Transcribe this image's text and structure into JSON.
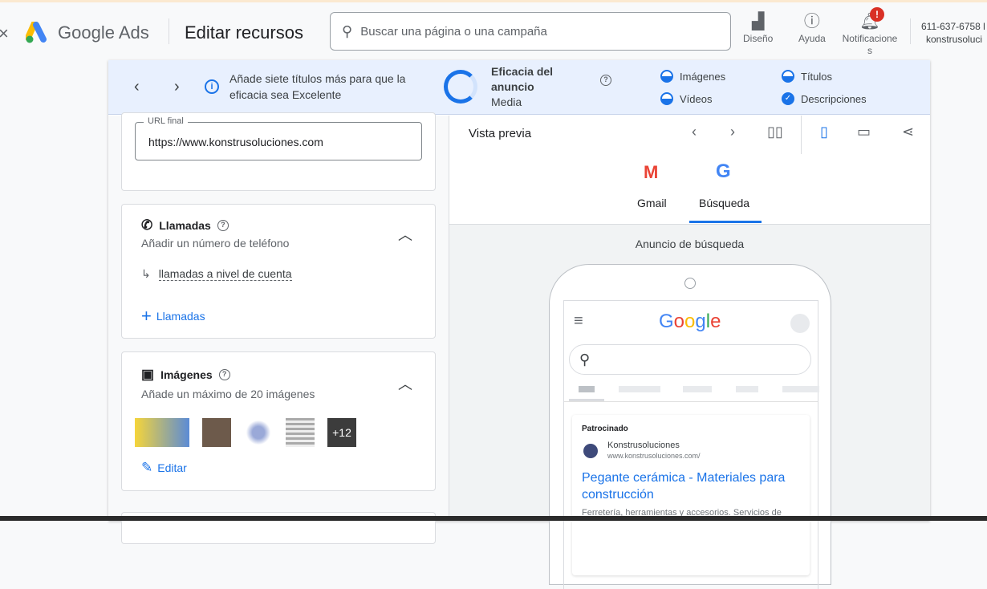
{
  "header": {
    "close": "×",
    "product": "Google Ads",
    "title": "Editar recursos",
    "search_placeholder": "Buscar una página o una campaña",
    "buttons": [
      {
        "label": "Diseño"
      },
      {
        "label": "Ayuda"
      },
      {
        "label": "Notificaciones"
      }
    ],
    "badge": "!",
    "account_phone": "611-637-6758 l",
    "account_name": "konstrusoluci"
  },
  "banner": {
    "message": "Añade siete títulos más para que la eficacia sea Excelente",
    "strength_title": "Eficacia del anuncio",
    "strength_value": "Media",
    "checks": [
      {
        "label": "Imágenes",
        "state": "partial"
      },
      {
        "label": "Vídeos",
        "state": "partial"
      },
      {
        "label": "Títulos",
        "state": "partial"
      },
      {
        "label": "Descripciones",
        "state": "complete"
      }
    ]
  },
  "url": {
    "label": "URL final",
    "value": "https://www.konstrusoluciones.com"
  },
  "calls": {
    "title": "Llamadas",
    "subtitle": "Añadir un número de teléfono",
    "link": "llamadas a nivel de cuenta",
    "add": "Llamadas"
  },
  "images": {
    "title": "Imágenes",
    "subtitle": "Añade un máximo de 20 imágenes",
    "more": "+12",
    "edit": "Editar"
  },
  "preview": {
    "title": "Vista previa",
    "tabs": [
      "Gmail",
      "Búsqueda"
    ],
    "active_tab": "Búsqueda",
    "label": "Anuncio de búsqueda",
    "ad": {
      "sponsored": "Patrocinado",
      "advertiser": "Konstrusoluciones",
      "display_url": "www.konstrusoluciones.com/",
      "headline": "Pegante cerámica - Materiales para construcción",
      "description": "Ferretería, herramientas y accesorios. Servicios de"
    }
  },
  "colors": {
    "accent": "#1a73e8",
    "badge": "#d93025"
  }
}
